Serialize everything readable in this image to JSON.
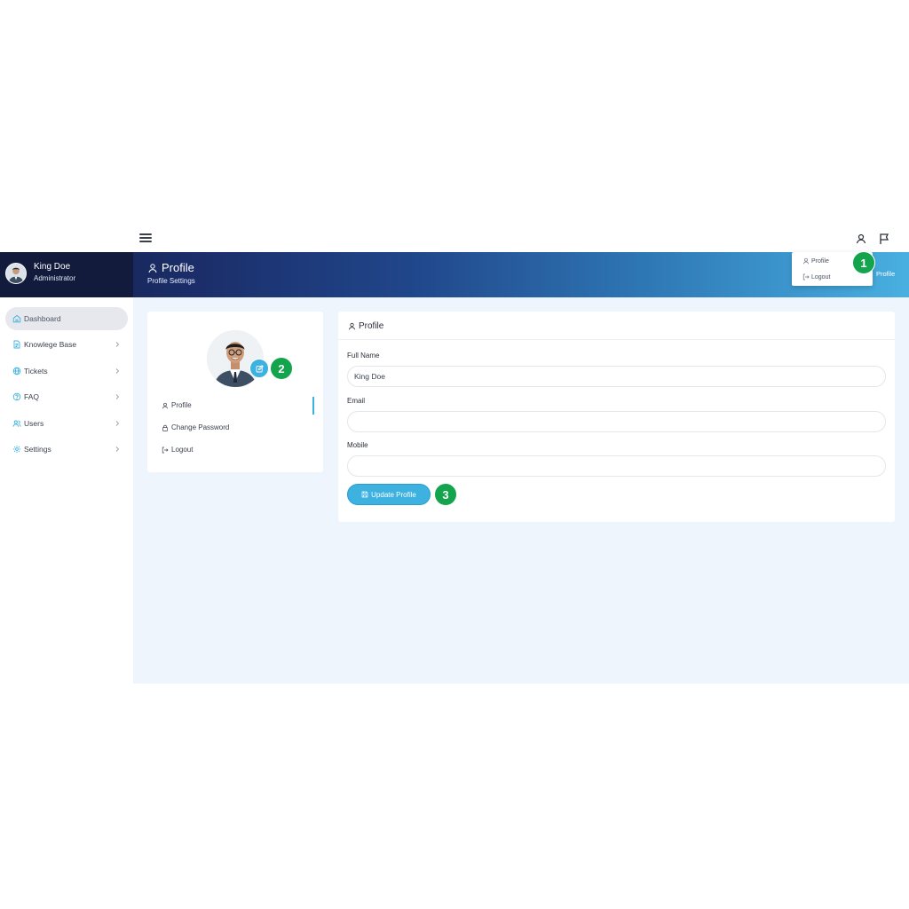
{
  "user": {
    "name": "King Doe",
    "role": "Administrator"
  },
  "banner": {
    "title": "Profile",
    "subtitle": "Profile Settings",
    "crumb": "Profile"
  },
  "dropdown": {
    "items": [
      {
        "label": "Profile"
      },
      {
        "label": "Logout"
      }
    ]
  },
  "badges": [
    "1",
    "2",
    "3"
  ],
  "sidebar": {
    "items": [
      {
        "label": "Dashboard",
        "icon": "home-icon",
        "active": true
      },
      {
        "label": "Knowlege Base",
        "icon": "document-icon"
      },
      {
        "label": "Tickets",
        "icon": "globe-icon"
      },
      {
        "label": "FAQ",
        "icon": "help-icon"
      },
      {
        "label": "Users",
        "icon": "users-icon"
      },
      {
        "label": "Settings",
        "icon": "gear-icon"
      }
    ]
  },
  "profile_menu": {
    "items": [
      {
        "label": "Profile"
      },
      {
        "label": "Change Password"
      },
      {
        "label": "Logout"
      }
    ]
  },
  "form": {
    "title": "Profile",
    "full_name_label": "Full Name",
    "full_name_value": "King Doe",
    "email_label": "Email",
    "email_value": "",
    "mobile_label": "Mobile",
    "mobile_value": "",
    "submit_label": "Update Profile"
  },
  "colors": {
    "accent": "#3db1e0",
    "badge": "#14a44d",
    "navy": "#121b3c",
    "content_bg": "#eef5fd"
  }
}
